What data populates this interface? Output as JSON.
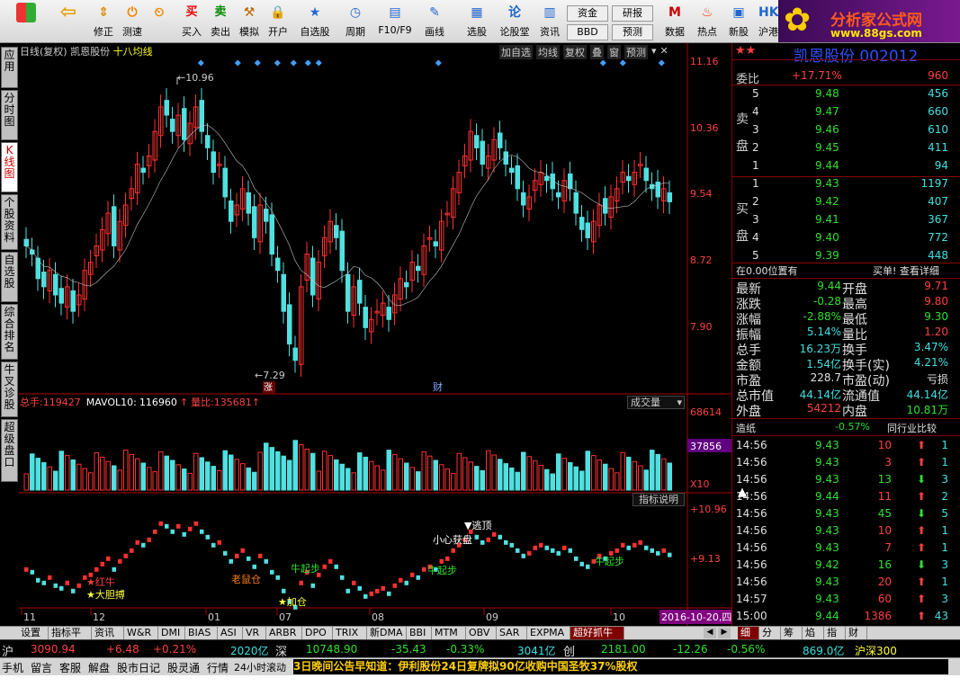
{
  "toolbar": {
    "buttons": [
      "",
      "修正",
      "测速",
      "买入",
      "卖出",
      "模拟",
      "开户",
      "自选股",
      "周期",
      "F10/F9",
      "画线",
      "选股",
      "论股堂",
      "资讯",
      "",
      "",
      "数据",
      "热点",
      "新股",
      "沪港"
    ],
    "pills": [
      "资金",
      "研报",
      "BBD",
      "预测"
    ]
  },
  "logo": {
    "line1": "分析家公式网",
    "line2": "www.88gs.com"
  },
  "sidebar": {
    "tabs": [
      "应用",
      "分时图",
      "K线图",
      "个股资料",
      "自选股",
      "综合排名",
      "牛叉诊股",
      "超级盘口"
    ]
  },
  "chart": {
    "header": {
      "period": "日线(复权)",
      "name": "凯恩股份",
      "indicator": "十八均线"
    },
    "header_buttons": [
      "加自选",
      "均线",
      "复权",
      "叠",
      "窗",
      "预测"
    ],
    "price_ticks": [
      "11.16",
      "10.36",
      "9.54",
      "8.72",
      "7.90"
    ],
    "high_label": "10.96",
    "low_label": "7.29",
    "event_labels": [
      "涨",
      "财"
    ],
    "vol_header": {
      "total_label": "总手:",
      "total": "119427",
      "mavol_label": "MAVOL10:",
      "mavol": "116960",
      "ratio_label": "量比:",
      "ratio": "135681"
    },
    "vol_selector": "成交量",
    "vol_ticks": [
      "68614",
      "37856",
      "X10"
    ],
    "ind_button": "指标说明",
    "ind_ticks": [
      "+10.96",
      "+9.13"
    ],
    "ind_labels": [
      "红牛",
      "大胆搏",
      "老鼠仓",
      "加仓",
      "牛起步",
      "牛起步",
      "小心获盘",
      "逃顶",
      "牛起步"
    ],
    "months": [
      "11",
      "12",
      "01",
      "07",
      "08",
      "09",
      "10"
    ],
    "date_label": "2016-10-20,四"
  },
  "quote": {
    "title": "凯恩股份 002012",
    "weibi": {
      "label": "委比",
      "pct": "+17.71%",
      "val": "960"
    },
    "sell": [
      {
        "lv": "5",
        "p": "9.48",
        "v": "456"
      },
      {
        "lv": "4",
        "p": "9.47",
        "v": "660"
      },
      {
        "lv": "3",
        "p": "9.46",
        "v": "610"
      },
      {
        "lv": "2",
        "p": "9.45",
        "v": "411"
      },
      {
        "lv": "1",
        "p": "9.44",
        "v": "94"
      }
    ],
    "buy": [
      {
        "lv": "1",
        "p": "9.43",
        "v": "1197"
      },
      {
        "lv": "2",
        "p": "9.42",
        "v": "407"
      },
      {
        "lv": "3",
        "p": "9.41",
        "v": "367"
      },
      {
        "lv": "4",
        "p": "9.40",
        "v": "772"
      },
      {
        "lv": "5",
        "p": "9.39",
        "v": "448"
      }
    ],
    "sell_label": "卖盘",
    "buy_label": "买盘",
    "pos": "在0.00位置有",
    "buy1": "买单! 查看详细",
    "stats": [
      [
        "最新",
        "9.44",
        "开盘",
        "9.71"
      ],
      [
        "涨跌",
        "-0.28",
        "最高",
        "9.80"
      ],
      [
        "涨幅",
        "-2.88%",
        "最低",
        "9.30"
      ],
      [
        "振幅",
        "5.14%",
        "量比",
        "1.20"
      ],
      [
        "总手",
        "16.23万",
        "换手",
        "3.47%"
      ],
      [
        "金额",
        "1.54亿",
        "换手(实)",
        "4.21%"
      ],
      [
        "市盈",
        "228.7",
        "市盈(动)",
        "亏损"
      ],
      [
        "总市值",
        "44.14亿",
        "流通值",
        "44.14亿"
      ],
      [
        "外盘",
        "54212",
        "内盘",
        "10.81万"
      ]
    ],
    "sector": {
      "name": "造纸",
      "pct": "-0.57%",
      "cmp": "同行业比较"
    },
    "ticks": [
      [
        "14:56",
        "9.43",
        "10",
        "up",
        "1"
      ],
      [
        "14:56",
        "9.43",
        "3",
        "up",
        "1"
      ],
      [
        "14:56",
        "9.43",
        "13",
        "down",
        "3"
      ],
      [
        "14:56",
        "9.44",
        "11",
        "up",
        "2"
      ],
      [
        "14:56",
        "9.43",
        "45",
        "down",
        "5"
      ],
      [
        "14:56",
        "9.43",
        "10",
        "up",
        "1"
      ],
      [
        "14:56",
        "9.43",
        "7",
        "up",
        "1"
      ],
      [
        "14:56",
        "9.42",
        "16",
        "down",
        "3"
      ],
      [
        "14:56",
        "9.43",
        "20",
        "up",
        "1"
      ],
      [
        "14:57",
        "9.43",
        "60",
        "up",
        "3"
      ],
      [
        "15:00",
        "9.44",
        "1386",
        "up",
        "43"
      ]
    ]
  },
  "bottom_tabs": [
    "设置",
    "指标平台",
    "资讯",
    "W&R",
    "DMI",
    "BIAS",
    "ASI",
    "VR",
    "ARBR",
    "DPO",
    "TRIX",
    "新DMA",
    "BBI",
    "MTM",
    "OBV",
    "SAR",
    "EXPMA",
    "超好抓牛"
  ],
  "right_tabs": [
    "细",
    "分",
    "筹",
    "焰",
    "指",
    "财"
  ],
  "index_bar": {
    "sh_label": "沪",
    "sh": "3090.94",
    "sh_chg": "+6.48",
    "sh_pct": "+0.21%",
    "sh_amt": "2020亿",
    "sz_label": "深",
    "sz": "10748.90",
    "sz_chg": "-35.43",
    "sz_pct": "-0.33%",
    "sz_amt": "3041亿",
    "cy_label": "创",
    "cy": "2181.00",
    "cy_chg": "-12.26",
    "cy_pct": "-0.56%",
    "hs_amt": "869.0亿",
    "hs_label": "沪深300"
  },
  "status_bar": {
    "items": [
      "手机",
      "留言",
      "客服",
      "解盘",
      "股市日记",
      "股灵通",
      "行情",
      "24小时滚动"
    ],
    "news": "3日晚间公告早知道：伊利股份24日复牌拟90亿收购中国圣牧37%股权"
  }
}
